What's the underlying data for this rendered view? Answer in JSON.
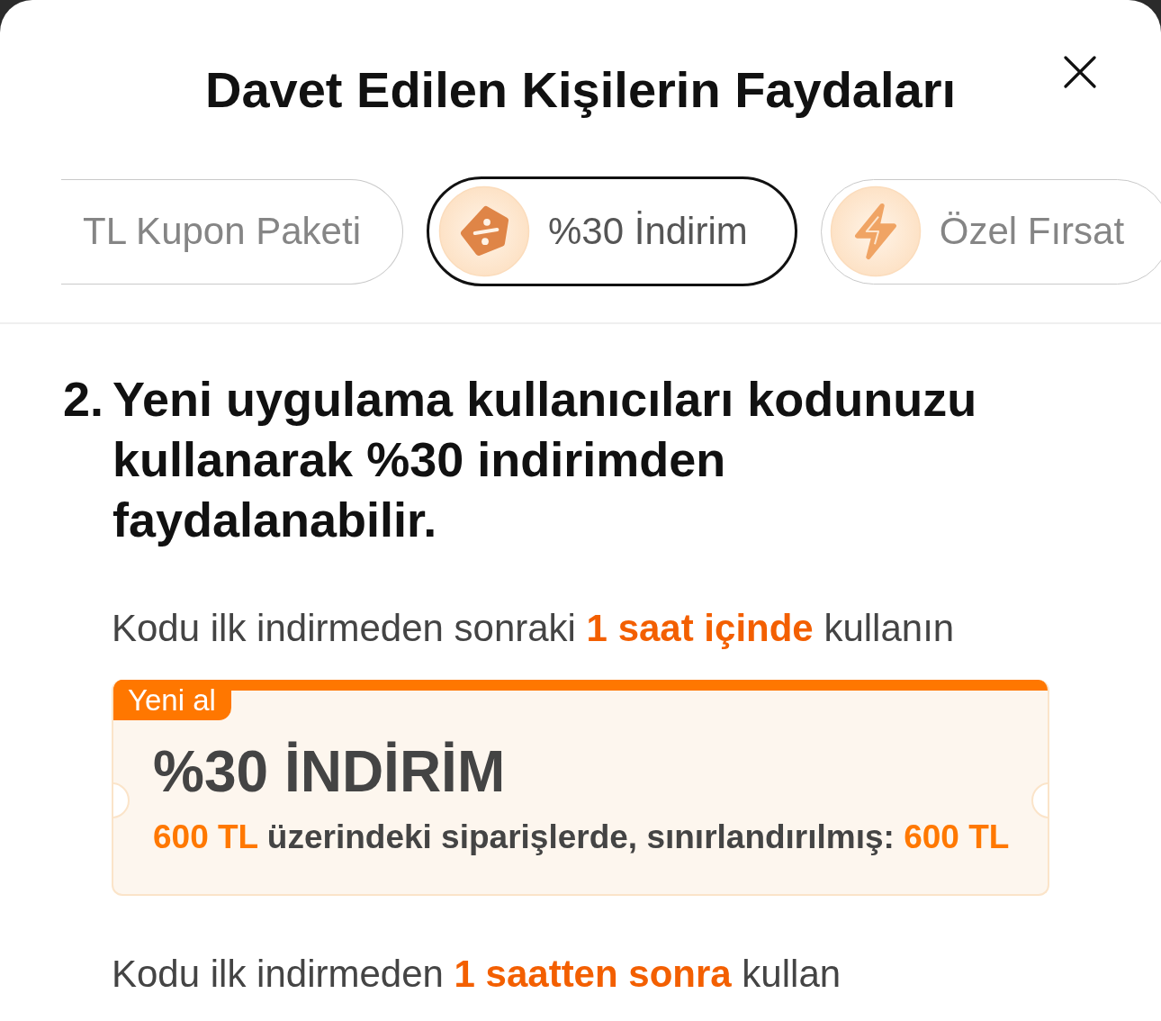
{
  "header": {
    "title": "Davet Edilen Kişilerin Faydaları"
  },
  "tabs": [
    {
      "label": "TL Kupon Paketi",
      "kind": "plain",
      "selected": false
    },
    {
      "label": "%30 İndirim",
      "kind": "discount",
      "selected": true
    },
    {
      "label": "Özel Fırsat",
      "kind": "flash",
      "selected": false
    }
  ],
  "benefit": {
    "number": "2.",
    "text": "Yeni uygulama kullanıcıları kodunuzu kullanarak %30 indirimden faydalanabilir."
  },
  "offers": [
    {
      "note": [
        {
          "text": "Kodu ilk indirmeden sonraki ",
          "highlight": false
        },
        {
          "text": "1 saat içinde",
          "highlight": true
        },
        {
          "text": " kullanın",
          "highlight": false
        }
      ],
      "coupon": {
        "badge": "Yeni al",
        "title": "%30 İNDİRİM",
        "condition": [
          {
            "text": "600 TL",
            "highlight": true
          },
          {
            "text": " üzerindeki siparişlerde, sınırlandırılmış: ",
            "highlight": false
          },
          {
            "text": "600 TL",
            "highlight": true
          }
        ]
      }
    },
    {
      "note": [
        {
          "text": "Kodu ilk indirmeden ",
          "highlight": false
        },
        {
          "text": "1 saatten sonra",
          "highlight": true
        },
        {
          "text": " kullan",
          "highlight": false
        }
      ]
    }
  ]
}
